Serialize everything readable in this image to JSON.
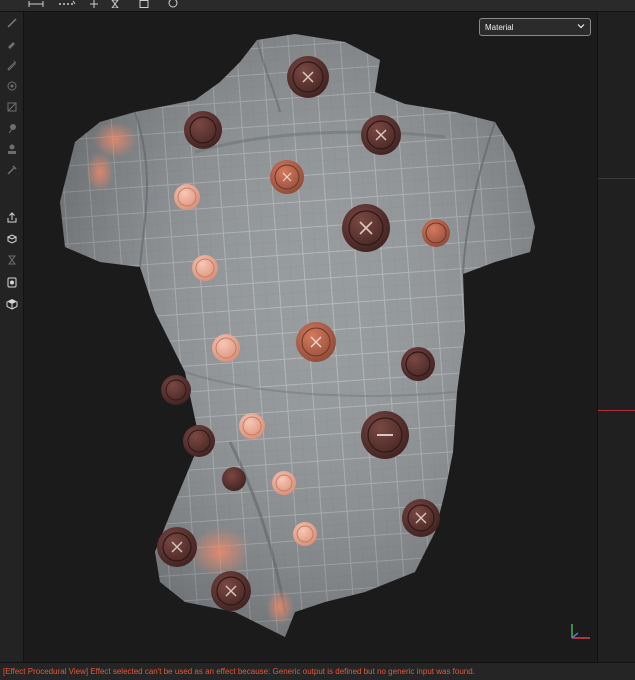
{
  "toolbar": {
    "icons": [
      "measure-icon",
      "dotted-grid-icon",
      "transform-icon",
      "hourglass-icon",
      "frame-icon",
      "info-icon"
    ]
  },
  "left_toolbar": {
    "icons": [
      "paint-brush-icon",
      "eraser-icon",
      "pen-icon",
      "stamp-circle-icon",
      "mask-icon",
      "smudge-icon",
      "clone-stamp-icon",
      "eyedropper-icon",
      "export-icon",
      "bake-icon",
      "layers-icon",
      "camera-icon",
      "cube-icon"
    ]
  },
  "viewport": {
    "material_select": {
      "value": "Material"
    },
    "colors": {
      "fabric": "#8e9396",
      "fabric_dark": "#6f7476",
      "grid": "#b8bdc0",
      "button_dark": "#5a3330",
      "button_light": "#e8a58f",
      "button_orange": "#b8624a",
      "highlight": "#e87a5a"
    }
  },
  "status_bar": {
    "message": "[Effect Procedural View] Effect selected can't be used as an effect because: Generic output is defined but no generic input was found.",
    "color": "#e05a3a"
  },
  "right_panel": {
    "accent_color": "#b0303a"
  }
}
